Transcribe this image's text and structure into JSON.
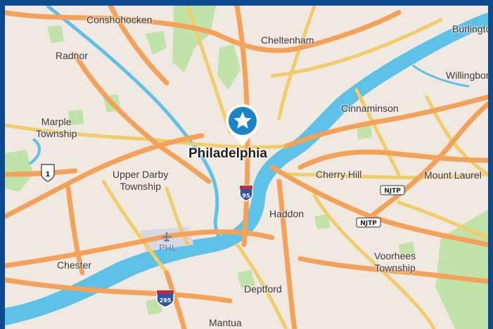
{
  "map": {
    "colors": {
      "land": "#efe9e2",
      "water": "#5ec1e8",
      "park": "#bfe3a8",
      "major_road": "#f4a25a",
      "minor_road": "#f3cc6a",
      "frame": "#0b4a8f",
      "marker": "#1b84c6"
    },
    "marker": {
      "icon": "star-icon"
    },
    "places": {
      "philadelphia": "Philadelphia",
      "conshohocken": "Conshohocken",
      "cheltenham": "Cheltenham",
      "burlington": "Burlington",
      "radnor": "Radnor",
      "willingboro": "Willingbor",
      "marple_line1": "Marple",
      "marple_line2": "Township",
      "cinnaminson": "Cinnaminson",
      "upper_darby_line1": "Upper Darby",
      "upper_darby_line2": "Township",
      "cherry_hill": "Cherry Hill",
      "mount_laurel": "Mount Laurel",
      "haddon": "Haddon",
      "chester": "Chester",
      "voorhees_line1": "Voorhees",
      "voorhees_line2": "Township",
      "deptford": "Deptford",
      "mantua": "Mantua"
    },
    "airport": {
      "code": "PHL",
      "icon": "airplane-icon"
    },
    "shields": {
      "us_route": "1",
      "i95": "95",
      "i295": "295",
      "njtp_1": "NJTP",
      "njtp_2": "NJTP"
    }
  }
}
